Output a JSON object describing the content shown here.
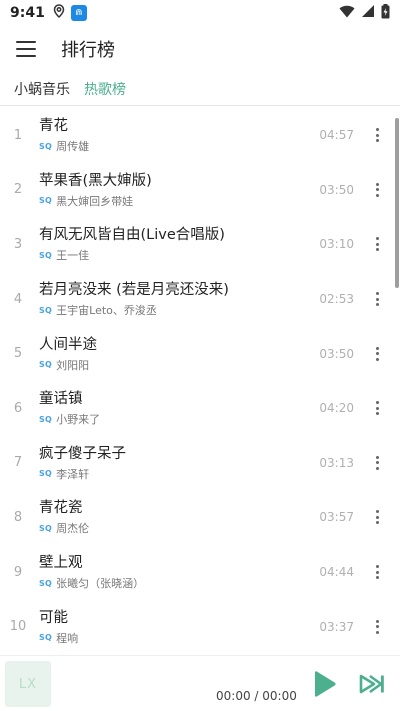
{
  "status_bar": {
    "time": "9:41",
    "app_badge": "⋒"
  },
  "app_bar": {
    "title": "排行榜"
  },
  "sub_header": {
    "source": "小蜗音乐",
    "board": "热歌榜"
  },
  "songs": [
    {
      "index": "1",
      "title": "青花",
      "quality": "SQ",
      "artist": "周传雄",
      "duration": "04:57"
    },
    {
      "index": "2",
      "title": "苹果香(黑大婶版)",
      "quality": "SQ",
      "artist": "黑大婶回乡带娃",
      "duration": "03:50"
    },
    {
      "index": "3",
      "title": "有风无风皆自由(Live合唱版)",
      "quality": "SQ",
      "artist": "王一佳",
      "duration": "03:10"
    },
    {
      "index": "4",
      "title": "若月亮没来 (若是月亮还没来)",
      "quality": "SQ",
      "artist": "王宇宙Leto、乔浚丞",
      "duration": "02:53"
    },
    {
      "index": "5",
      "title": "人间半途",
      "quality": "SQ",
      "artist": "刘阳阳",
      "duration": "03:50"
    },
    {
      "index": "6",
      "title": "童话镇",
      "quality": "SQ",
      "artist": "小野来了",
      "duration": "04:20"
    },
    {
      "index": "7",
      "title": "疯子傻子呆子",
      "quality": "SQ",
      "artist": "李泽轩",
      "duration": "03:13"
    },
    {
      "index": "8",
      "title": "青花瓷",
      "quality": "SQ",
      "artist": "周杰伦",
      "duration": "03:57"
    },
    {
      "index": "9",
      "title": "壁上观",
      "quality": "SQ",
      "artist": "张曦匀（张晓涵）",
      "duration": "04:44"
    },
    {
      "index": "10",
      "title": "可能",
      "quality": "SQ",
      "artist": "程响",
      "duration": "03:37"
    }
  ],
  "player": {
    "cover_text": "LX",
    "time": "00:00 / 00:00",
    "accent_color": "#4caf8e"
  }
}
